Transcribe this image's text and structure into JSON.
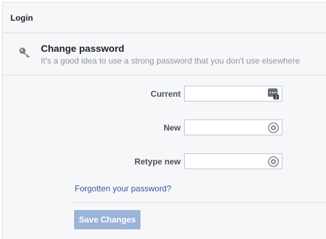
{
  "panel": {
    "title": "Login"
  },
  "change_password": {
    "title": "Change password",
    "subtitle": "It's a good idea to use a strong password that you don't use elsewhere",
    "icon": "key-icon"
  },
  "form": {
    "fields": [
      {
        "label": "Current",
        "value": "",
        "badge_icon": "password-manager-icon"
      },
      {
        "label": "New",
        "value": "",
        "badge_icon": "lastpass-icon"
      },
      {
        "label": "Retype new",
        "value": "",
        "badge_icon": "lastpass-icon"
      }
    ],
    "forgot_link": "Forgotten your password?",
    "save_label": "Save Changes"
  },
  "colors": {
    "link": "#365899",
    "button_disabled": "#9cb4d8",
    "border": "#dddfe2",
    "panel_bg": "#f6f7f9"
  }
}
